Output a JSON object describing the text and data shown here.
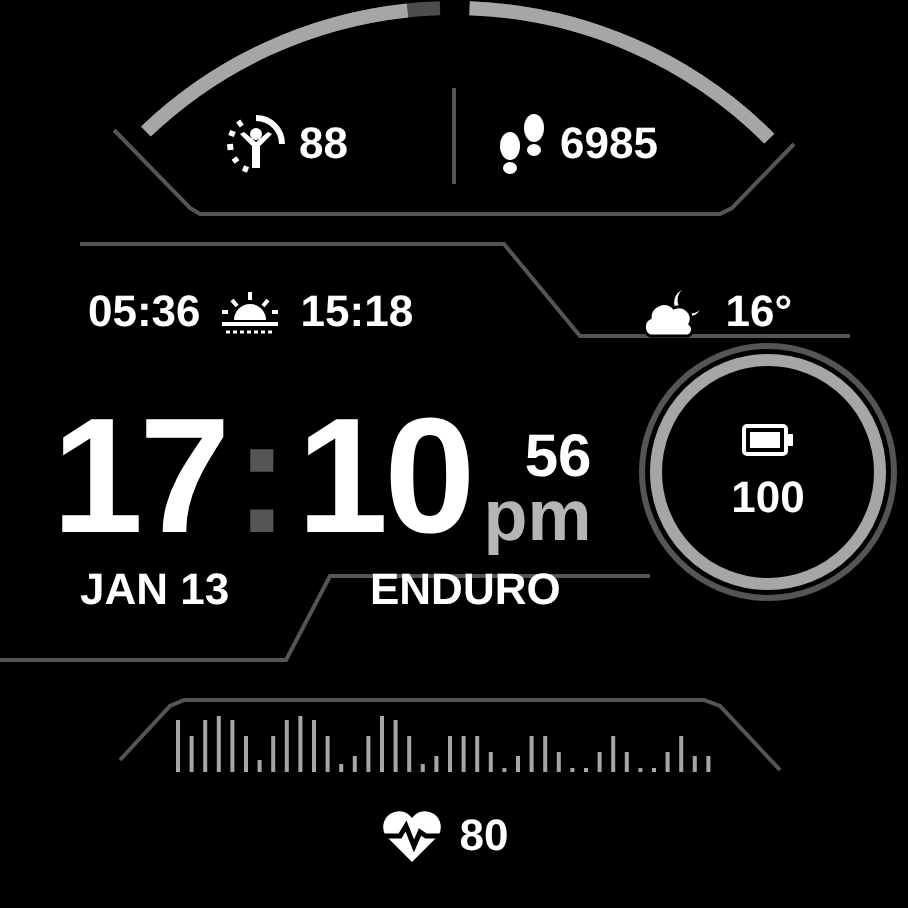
{
  "top_gauges": [
    {
      "kind": "body_battery",
      "value": "88"
    },
    {
      "kind": "steps",
      "value": "6985"
    }
  ],
  "sun": {
    "sunrise": "05:36",
    "sunset": "15:18"
  },
  "weather": {
    "temperature": "16°"
  },
  "time": {
    "hours": "17",
    "separator": ":",
    "minutes": "10",
    "seconds": "56",
    "period": "pm"
  },
  "battery": {
    "value": "100"
  },
  "date": "JAN 13",
  "activity": "ENDURO",
  "heart_rate": {
    "value": "80"
  }
}
